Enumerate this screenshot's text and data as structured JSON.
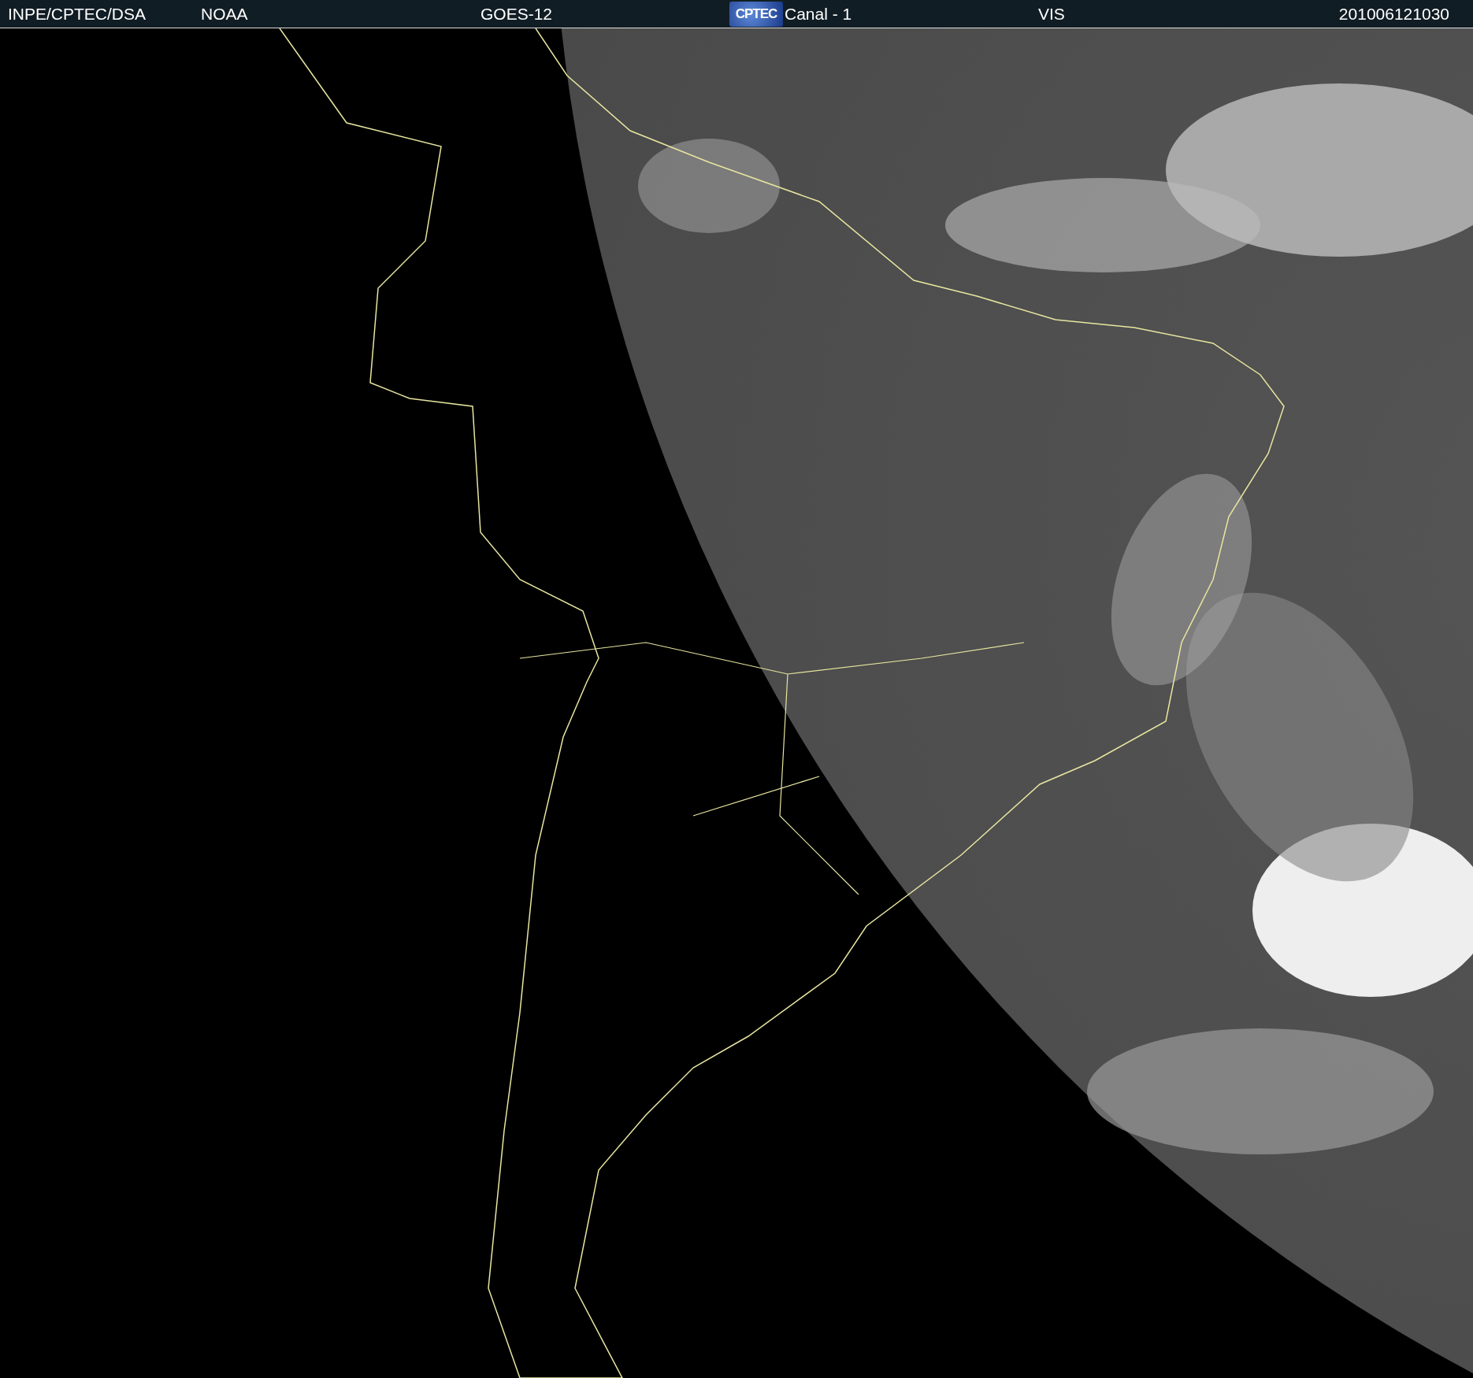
{
  "header": {
    "items": [
      {
        "kind": "text",
        "text": "INPE/CPTEC/DSA"
      },
      {
        "kind": "text",
        "text": "NOAA"
      },
      {
        "kind": "text",
        "text": "GOES-12"
      },
      {
        "kind": "logo",
        "text": "CPTEC"
      },
      {
        "kind": "text",
        "text": "Canal - 1"
      },
      {
        "kind": "text",
        "text": "VIS"
      },
      {
        "kind": "text",
        "text": "201006121030"
      }
    ]
  }
}
